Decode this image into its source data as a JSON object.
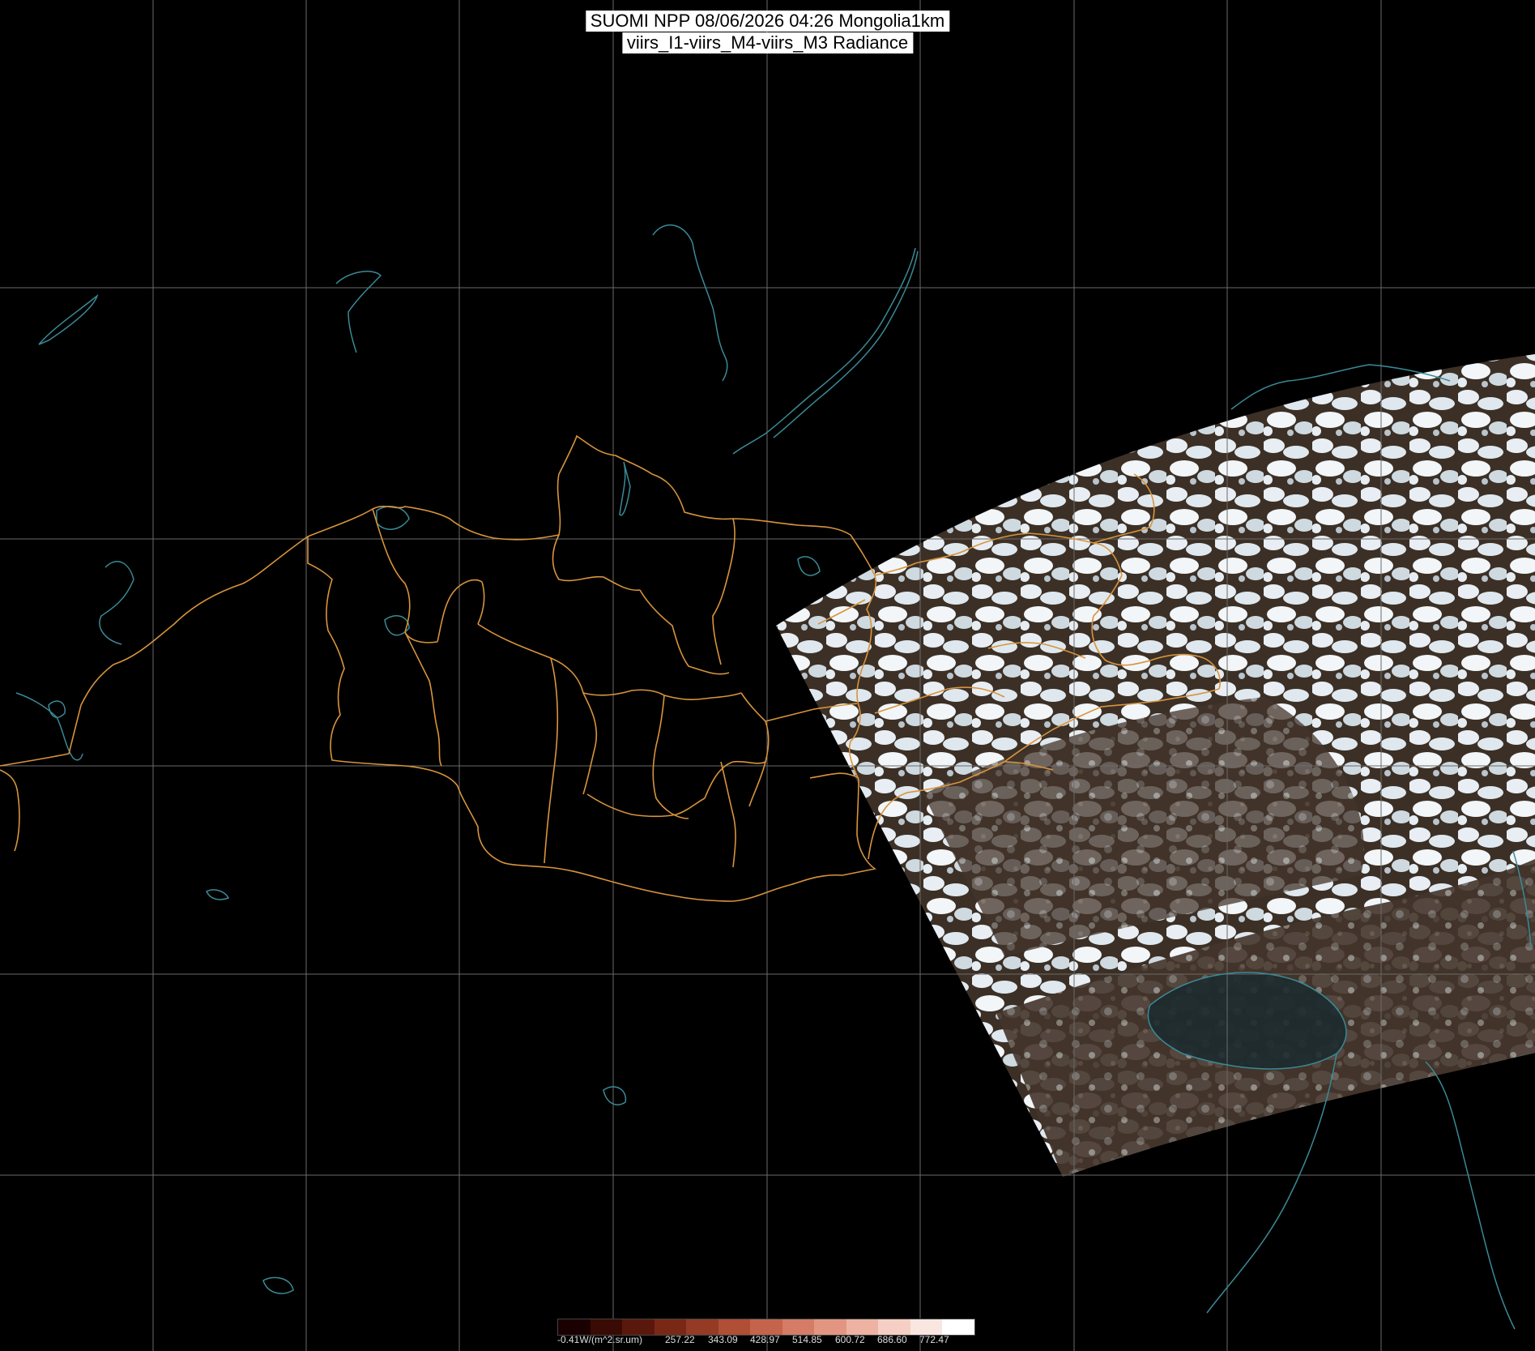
{
  "title": {
    "line1": "SUOMI NPP 08/06/2026 04:26 Mongolia1km",
    "line2": "viirs_I1-viirs_M4-viirs_M3 Radiance"
  },
  "colorbar": {
    "unit_label": "-0.41W/(m^2.sr.um)",
    "tick_labels": [
      "257.22",
      "343.09",
      "428.97",
      "514.85",
      "600.72",
      "686.60",
      "772.47"
    ],
    "colors": [
      "#1a0000",
      "#3a0a04",
      "#5a180c",
      "#7a2816",
      "#953a24",
      "#b04e36",
      "#c4644c",
      "#d47c66",
      "#e29682",
      "#edb2a2",
      "#f5cfc4",
      "#fae6e0",
      "#ffffff"
    ]
  },
  "colors": {
    "background": "#000000",
    "grid": "#6a6a6a",
    "coast": "#3a8a96",
    "admin_border": "#d8943c",
    "cloud": "#eef4f8",
    "land": "#4a3a2e"
  },
  "map": {
    "region": "Mongolia1km",
    "layers": [
      "graticule",
      "coastlines",
      "administrative-borders",
      "satellite-swath"
    ]
  }
}
